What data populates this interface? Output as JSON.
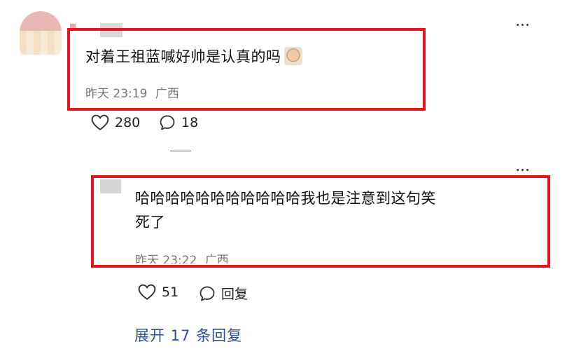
{
  "comment": {
    "text": "对着王祖蓝喊好帅是认真的吗",
    "emoji": "face-emoji",
    "time": "昨天 23:19",
    "location": "广西",
    "likes": "280",
    "replies": "18"
  },
  "reply": {
    "text_line1": "哈哈哈哈哈哈哈哈哈哈哈我也是注意到这句笑",
    "text_line2": "死了",
    "time": "昨天 23:22",
    "location": "广西",
    "likes": "51",
    "reply_label": "回复"
  },
  "expand_label": "展开 17 条回复",
  "colors": {
    "highlight": "#e8141f",
    "link": "#2f4f8f",
    "meta": "#777777"
  }
}
